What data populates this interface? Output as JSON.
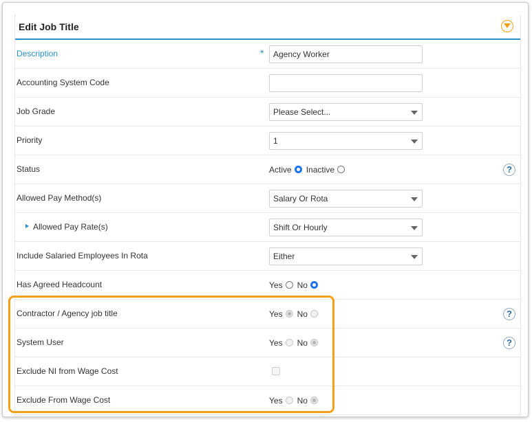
{
  "header": {
    "title": "Edit  Job Title"
  },
  "rows": {
    "description": {
      "label": "Description",
      "required": "*",
      "value": "Agency Worker"
    },
    "accounting": {
      "label": "Accounting System Code",
      "value": ""
    },
    "job_grade": {
      "label": "Job Grade",
      "value": "Please Select..."
    },
    "priority": {
      "label": "Priority",
      "value": "1"
    },
    "status": {
      "label": "Status",
      "active": "Active",
      "inactive": "Inactive",
      "selected": "Active"
    },
    "pay_method": {
      "label": "Allowed Pay Method(s)",
      "value": "Salary Or Rota"
    },
    "pay_rate": {
      "label": "Allowed Pay Rate(s)",
      "value": "Shift Or Hourly"
    },
    "salaried": {
      "label": "Include Salaried Employees In Rota",
      "value": "Either"
    },
    "headcount": {
      "label": "Has Agreed Headcount",
      "yes": "Yes",
      "no": "No",
      "selected": "No"
    },
    "contractor": {
      "label": "Contractor / Agency job title",
      "yes": "Yes",
      "no": "No",
      "selected": "Yes",
      "disabled": true
    },
    "system_user": {
      "label": "System User",
      "yes": "Yes",
      "no": "No",
      "selected": "No",
      "disabled": true
    },
    "exclude_ni": {
      "label": "Exclude NI from Wage Cost",
      "checked": false,
      "disabled": true
    },
    "exclude_wage": {
      "label": "Exclude From Wage Cost",
      "yes": "Yes",
      "no": "No",
      "selected": "No",
      "disabled": true
    }
  },
  "help_icon": "?",
  "colors": {
    "accent": "#2a8fc7",
    "highlight": "#f5a01a",
    "radio_on": "#1a73e8"
  }
}
